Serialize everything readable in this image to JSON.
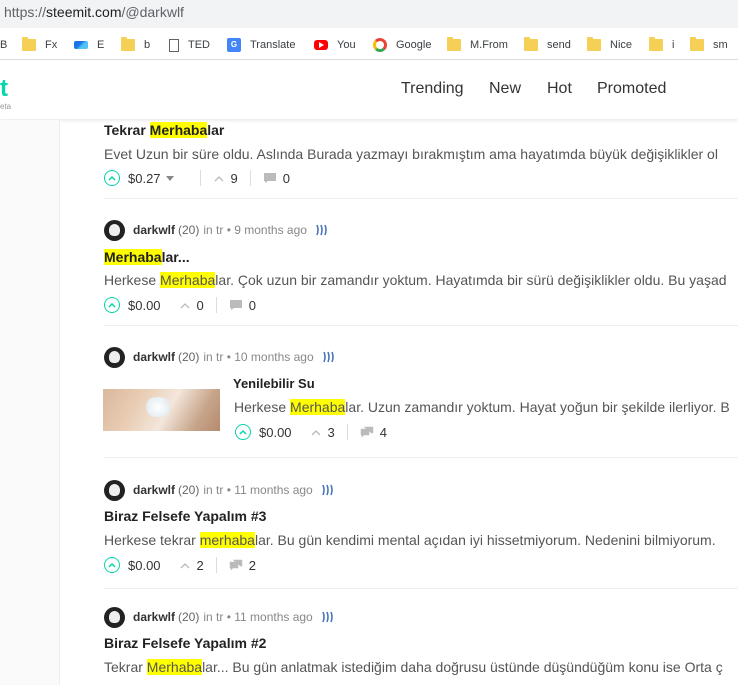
{
  "browser": {
    "url_scheme": "https://",
    "url_host": "steemit.com",
    "url_path": "/@darkwlf",
    "bookmarks": [
      {
        "label": "B",
        "icon": "folder-icon"
      },
      {
        "label": "Fx",
        "icon": "folder-icon"
      },
      {
        "label": "E",
        "icon": "waves-icon"
      },
      {
        "label": "b",
        "icon": "folder-icon"
      },
      {
        "label": "TED",
        "icon": "page-icon"
      },
      {
        "label": "Translate",
        "icon": "google-translate-icon"
      },
      {
        "label": "You",
        "icon": "youtube-icon"
      },
      {
        "label": "Google",
        "icon": "google-icon"
      },
      {
        "label": "M.From",
        "icon": "folder-icon"
      },
      {
        "label": "send",
        "icon": "folder-icon"
      },
      {
        "label": "Nice",
        "icon": "folder-icon"
      },
      {
        "label": "i",
        "icon": "folder-icon"
      },
      {
        "label": "sm",
        "icon": "folder-icon"
      }
    ]
  },
  "header": {
    "logo_letter": "t",
    "logo_sub": "eta",
    "nav": [
      "Trending",
      "New",
      "Hot",
      "Promoted"
    ]
  },
  "colors": {
    "accent": "#06d6a9",
    "highlight": "#ffff00"
  },
  "posts": [
    {
      "title_pre": "Tekrar ",
      "title_hl": "Merhaba",
      "title_post": "lar",
      "body_pre": "Evet Uzun bir süre oldu. Aslında Burada yazmayı bırakmıştım ama hayatımda büyük değişiklikler ol",
      "payout": "$0.27",
      "votes": "9",
      "comments": "0"
    },
    {
      "author": "darkwlf",
      "rep": "(20)",
      "meta": "in tr • 9 months ago",
      "title_pre": "",
      "title_hl": "Merhaba",
      "title_post": "lar...",
      "body_pre": "Herkese ",
      "body_hl": "Merhaba",
      "body_post": "lar. Çok uzun bir zamandır yoktum. Hayatımda bir sürü değişiklikler oldu. Bu yaşad",
      "payout": "$0.00",
      "votes": "0",
      "comments": "0"
    },
    {
      "author": "darkwlf",
      "rep": "(20)",
      "meta": "in tr • 10 months ago",
      "title_pre": "Yenilebilir Su",
      "body_pre": "Herkese ",
      "body_hl": "Merhaba",
      "body_post": "lar. Uzun zamandır yoktum. Hayat yoğun bir şekilde ilerliyor. B",
      "payout": "$0.00",
      "votes": "3",
      "comments": "4"
    },
    {
      "author": "darkwlf",
      "rep": "(20)",
      "meta": "in tr • 11 months ago",
      "title_pre": "Biraz Felsefe Yapalım #3",
      "body_pre": "Herkese tekrar ",
      "body_hl": "merhaba",
      "body_post": "lar. Bu gün kendimi mental açıdan iyi hissetmiyorum. Nedenini bilmiyorum.",
      "payout": "$0.00",
      "votes": "2",
      "comments": "2"
    },
    {
      "author": "darkwlf",
      "rep": "(20)",
      "meta": "in tr • 11 months ago",
      "title_pre": "Biraz Felsefe Yapalım #2",
      "body_pre": "Tekrar ",
      "body_hl": "Merhaba",
      "body_post": "lar... Bu gün anlatmak istediğim daha doğrusu üstünde düşündüğüm konu ise Orta ç"
    }
  ]
}
